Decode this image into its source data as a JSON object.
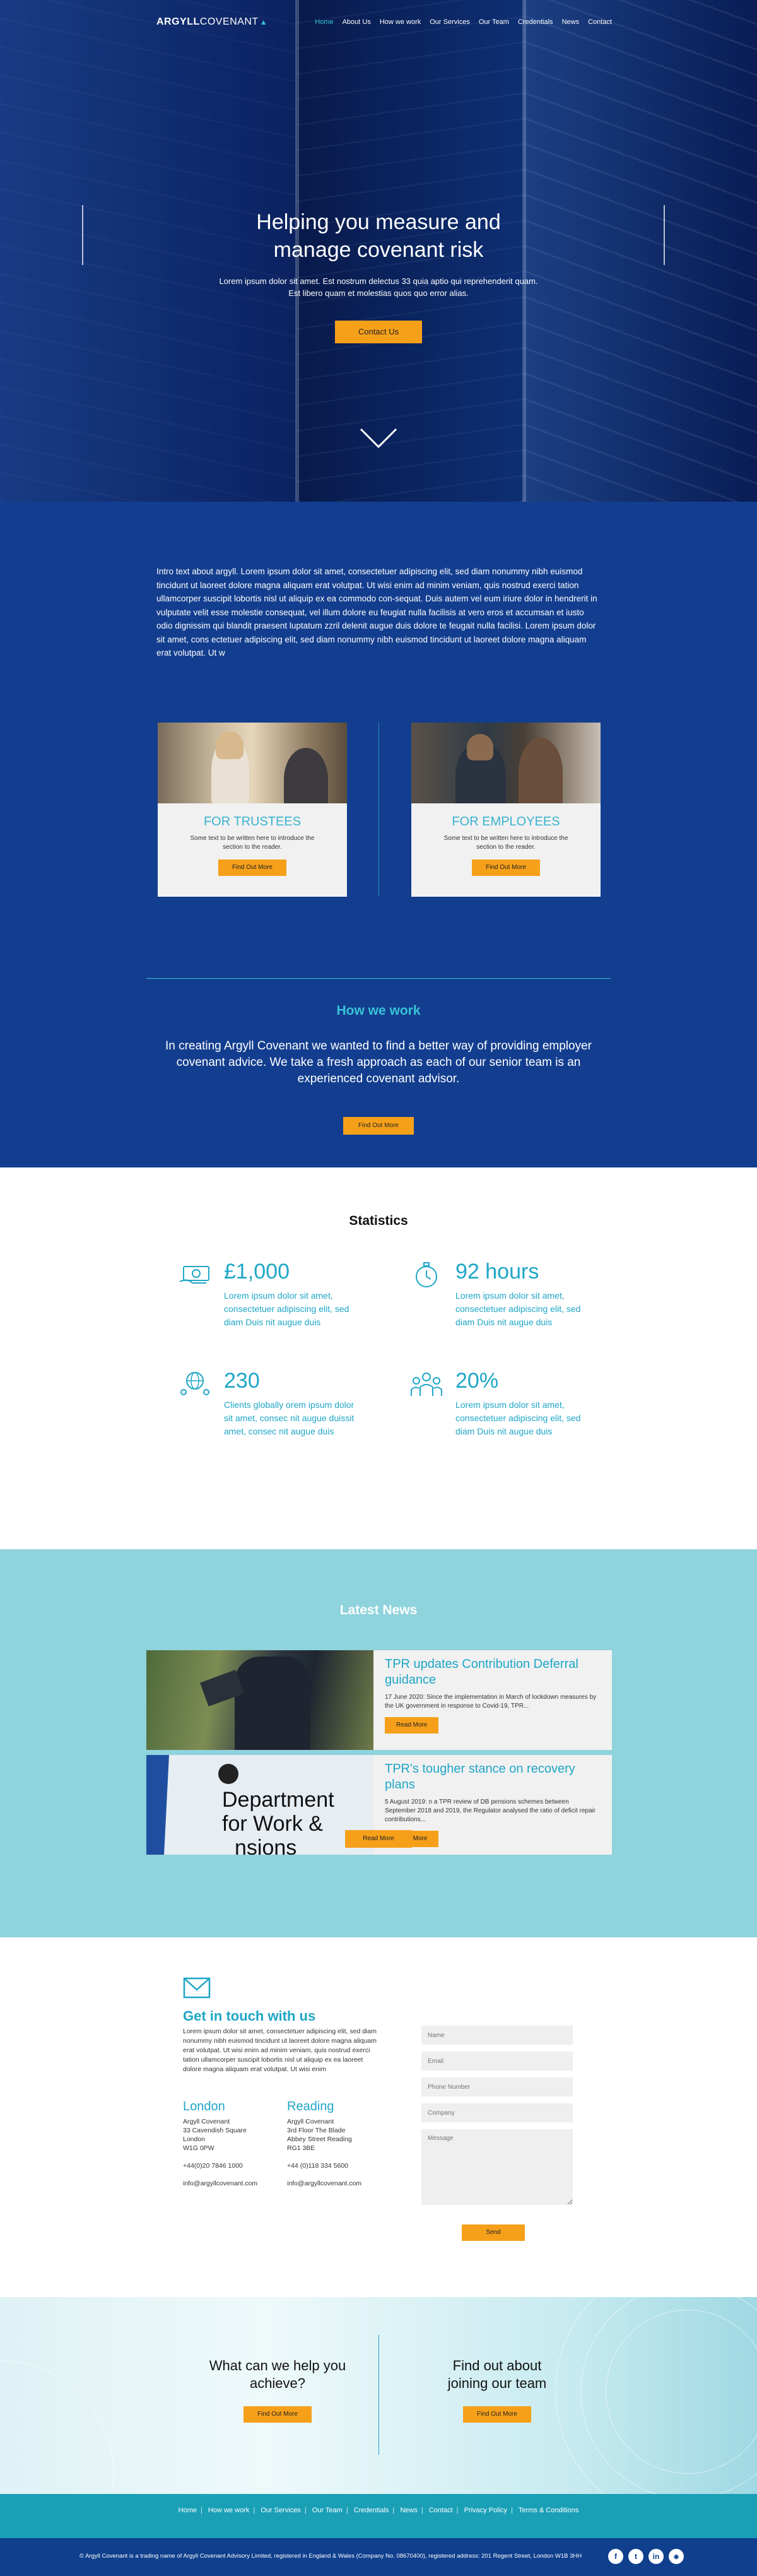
{
  "nav": {
    "logo_bold": "ARGYLL",
    "logo_light": "COVENANT",
    "items": [
      "Home",
      "About Us",
      "How we work",
      "Our Services",
      "Our Team",
      "Credentials",
      "News",
      "Contact"
    ]
  },
  "hero": {
    "title_line1": "Helping you measure and",
    "title_line2": "manage covenant risk",
    "text": "Lorem ipsum dolor sit amet. Est nostrum delectus 33 quia aptio qui reprehenderit quam. Est libero quam et molestias quos quo error alias.",
    "button": "Contact Us"
  },
  "intro": {
    "text": "Intro text about argyll. Lorem ipsum dolor sit amet, consectetuer adipiscing elit, sed diam nonummy nibh euismod tincidunt ut laoreet dolore magna aliquam erat volutpat. Ut wisi enim ad minim veniam, quis nostrud exerci tation ullamcorper suscipit lobortis nisl ut aliquip ex ea commodo con-sequat. Duis autem vel eum iriure dolor in hendrerit in vulputate velit esse molestie consequat, vel illum dolore eu feugiat nulla facilisis at vero eros et accumsan et iusto odio dignissim qui blandit praesent luptatum zzril delenit augue duis dolore te feugait nulla facilisi. Lorem ipsum dolor sit amet, cons ectetuer adipiscing elit, sed diam nonummy nibh euismod tincidunt ut laoreet dolore magna aliquam erat volutpat. Ut w"
  },
  "cards": [
    {
      "title": "FOR TRUSTEES",
      "text": "Some text to be written here to introduce the section to the reader.",
      "button": "Find Out More"
    },
    {
      "title": "FOR EMPLOYEES",
      "text": "Some text to be written here to introduce the section to the reader.",
      "button": "Find Out More"
    }
  ],
  "how": {
    "title": "How we work",
    "text": "In creating Argyll Covenant we wanted to find a better way of providing employer covenant advice. We take a fresh approach as each of our senior team is an experienced covenant advisor.",
    "button": "Find Out More"
  },
  "stats": {
    "title": "Statistics",
    "items": [
      {
        "value": "£1,000",
        "text": "Lorem ipsum dolor sit amet, consectetuer adipiscing elit, sed diam Duis nit augue duis",
        "icon": "money-icon"
      },
      {
        "value": "92 hours",
        "text": "Lorem ipsum dolor sit amet, consectetuer adipiscing elit, sed diam Duis nit augue duis",
        "icon": "stopwatch-icon"
      },
      {
        "value": "230",
        "text": "Clients globally orem ipsum dolor sit amet, consec nit augue duissit amet, consec nit augue duis",
        "icon": "globe-people-icon"
      },
      {
        "value": "20%",
        "text": "Lorem ipsum dolor sit amet, consectetuer adipiscing elit, sed diam Duis nit augue duis",
        "icon": "team-icon"
      }
    ]
  },
  "news": {
    "title": "Latest News",
    "items": [
      {
        "title": "TPR updates Contribution Deferral guidance",
        "text": "17 June 2020: Since the implementation in March of lockdown measures by the UK government in response to Covid-19, TPR...",
        "button": "Read More"
      },
      {
        "title": "TPR's tougher stance on recovery plans",
        "text": "5 August 2019: n a TPR review of DB pensions schemes between September 2018 and 2019, the Regulator analysed the ratio of deficit repair contributions...",
        "button": "Read More",
        "image_text_1": "Department",
        "image_text_2": "for Work &",
        "image_text_3": "nsions"
      }
    ],
    "more": "Read More"
  },
  "contact": {
    "title": "Get in touch with us",
    "text": "Lorem ipsum dolor sit amet, consectetuer adipiscing elit, sed diam nonummy nibh euismod tincidunt ut laoreet dolore magna aliquam erat volutpat. Ut wisi enim ad minim veniam, quis nostrud exerci tation ullamcorper suscipit lobortis nisl ut aliquip ex ea laoreet dolore magna aliquam erat volutpat. Ut wisi enim",
    "offices": [
      {
        "city": "London",
        "line1": "Argyll Covenant",
        "line2": "33 Cavendish Square",
        "line3": "London",
        "line4": "W1G 0PW",
        "phone": "+44(0)20 7846 1000",
        "email": "info@argyllcovenant.com"
      },
      {
        "city": "Reading",
        "line1": "Argyll Covenant",
        "line2": "3rd Floor The Blade",
        "line3": "Abbey Street Reading",
        "line4": "RG1 3BE",
        "phone": "+44 (0)118 334 5600",
        "email": "info@argyllcovenant.com"
      }
    ],
    "form": {
      "name": "Name",
      "email": "Email",
      "phone": "Phone Number",
      "company": "Company",
      "message": "Message",
      "send": "Send"
    }
  },
  "cta": [
    {
      "line1": "What can we help you",
      "line2": "achieve?",
      "button": "Find Out More"
    },
    {
      "line1": "Find out about",
      "line2": "joining our team",
      "button": "Find Out More"
    }
  ],
  "footer": {
    "links": [
      "Home",
      "How we work",
      "Our Services",
      "Our Team",
      "Credentials",
      "News",
      "Contact",
      "Privacy Policy",
      "Terms & Conditions"
    ],
    "legal": "© Argyll Covenant is a trading name of Argyll Covenant Advisory Limited, registered in England & Wales (Company No. 08670400), registered address: 201 Regent Street, London W1B 3HH",
    "social": [
      "f",
      "t",
      "in",
      "rss"
    ]
  },
  "colors": {
    "accent": "#39c2d7",
    "button": "#f6a01a",
    "navy": "#133e8f",
    "news_bg": "#8fd3dd"
  }
}
